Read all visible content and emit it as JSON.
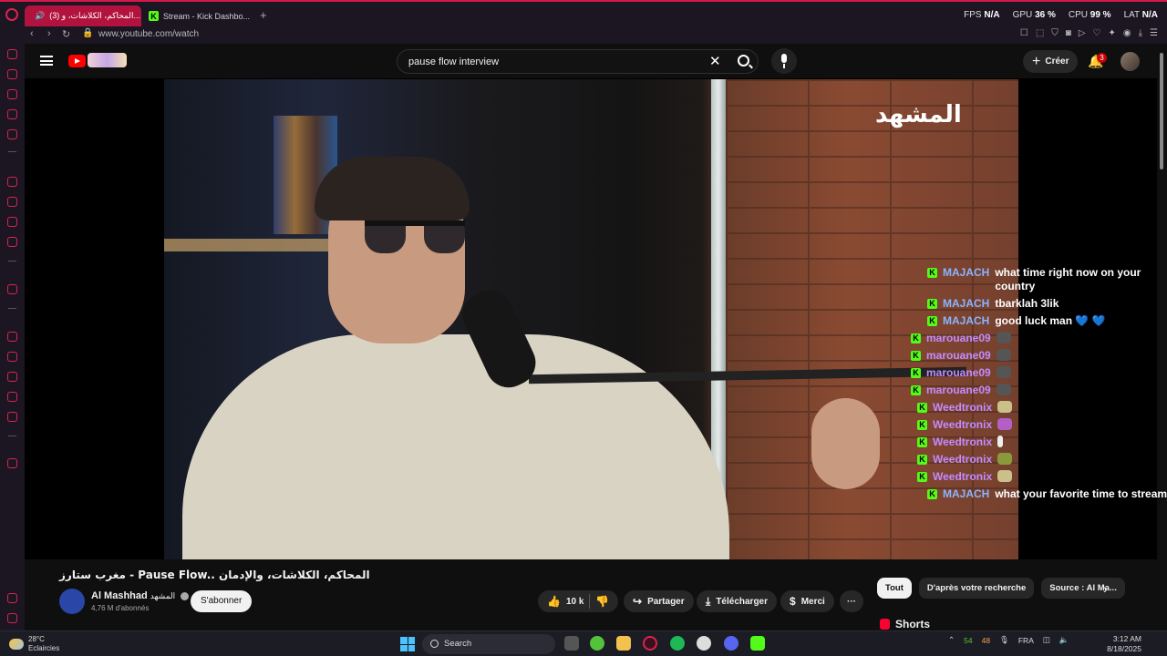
{
  "browser": {
    "tabs": [
      {
        "label": "(3) المحاكم، الكلاشات، و...",
        "active": true
      },
      {
        "label": "Stream - Kick Dashbo...",
        "active": false
      }
    ],
    "new_tab": "+",
    "stats": [
      {
        "label": "FPS",
        "value": "N/A"
      },
      {
        "label": "GPU",
        "value": "36 %"
      },
      {
        "label": "CPU",
        "value": "99 %"
      },
      {
        "label": "LAT",
        "value": "N/A"
      }
    ],
    "url": "www.youtube.com/watch"
  },
  "youtube": {
    "search_query": "pause flow interview",
    "create_label": "Créer",
    "notification_count": "3",
    "video_overlay_logo": "المشهد",
    "chat": [
      {
        "user": "MAJACH",
        "message": "what time right now on your country",
        "color": "majach"
      },
      {
        "user": "MAJACH",
        "message": "tbarklah 3lik",
        "color": "majach"
      },
      {
        "user": "MAJACH",
        "message": "good luck man 💙 💙",
        "color": "majach"
      },
      {
        "user": "marouane09",
        "message": "",
        "color": "purple"
      },
      {
        "user": "marouane09",
        "message": "",
        "color": "purple"
      },
      {
        "user": "marouane09",
        "message": "",
        "color": "purple"
      },
      {
        "user": "marouane09",
        "message": "",
        "color": "purple"
      },
      {
        "user": "Weedtronix",
        "message": "",
        "color": "purple"
      },
      {
        "user": "Weedtronix",
        "message": "",
        "color": "purple"
      },
      {
        "user": "Weedtronix",
        "message": "",
        "color": "purple"
      },
      {
        "user": "Weedtronix",
        "message": "",
        "color": "purple"
      },
      {
        "user": "Weedtronix",
        "message": "",
        "color": "purple"
      },
      {
        "user": "MAJACH",
        "message": "what your favorite time to stream",
        "color": "majach"
      }
    ],
    "video_title": "مغرب ستارز - Pause Flow.. المحاكم، الكلاشات، والإدمان",
    "channel_name": "Al Mashhad",
    "channel_name_ar": "المشهد",
    "subscribers": "4,76 M d'abonnés",
    "subscribe_label": "S'abonner",
    "likes": "10 k",
    "share_label": "Partager",
    "download_label": "Télécharger",
    "thanks_label": "Merci",
    "more_label": "···",
    "chips": [
      "Tout",
      "D'après votre recherche",
      "Source : Al Ma..."
    ],
    "shorts_label": "Shorts"
  },
  "taskbar": {
    "weather_temp": "28°C",
    "weather_desc": "Eclaircies",
    "search_label": "Search",
    "tray_num1": "54",
    "tray_num2": "48",
    "language": "FRA",
    "time": "3:12 AM",
    "date": "8/18/2025"
  },
  "colors": {
    "browser_accent": "#d8244f",
    "kick_green": "#53fc18",
    "youtube_red": "#ff0000"
  }
}
